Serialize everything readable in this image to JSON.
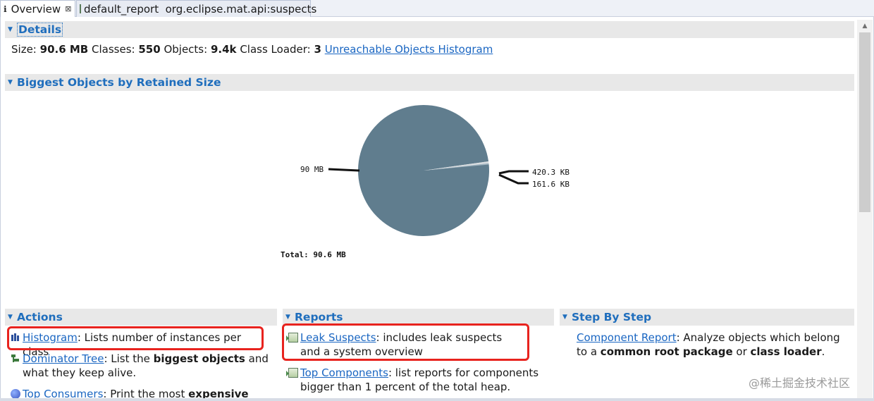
{
  "tabs": [
    {
      "icon": "info-icon",
      "label": "Overview",
      "close": "⊠"
    },
    {
      "icon": "report-icon",
      "label": "default_report  org.eclipse.mat.api:suspects"
    }
  ],
  "details": {
    "title": "Details",
    "size_label": "Size:",
    "size_value": "90.6 MB",
    "classes_label": "Classes:",
    "classes_value": "550",
    "objects_label": "Objects:",
    "objects_value": "9.4k",
    "loader_label": "Class Loader:",
    "loader_value": "3",
    "unreachable_link": "Unreachable Objects Histogram"
  },
  "biggest": {
    "title": "Biggest Objects by Retained Size"
  },
  "chart_data": {
    "type": "pie",
    "slices": [
      {
        "label": "90 MB",
        "value": 90.0,
        "color": "#607d8e"
      },
      {
        "label": "420.3 KB",
        "value": 0.4203,
        "color": "#d9dde0"
      },
      {
        "label": "161.6 KB",
        "value": 0.1616,
        "color": "#9fb3bf"
      }
    ],
    "total_label": "Total: 90.6 MB"
  },
  "actions": {
    "title": "Actions",
    "histogram_link": "Histogram",
    "histogram_desc": ": Lists number of instances per class",
    "dominator_link": "Dominator Tree",
    "dominator_desc1": ": List the ",
    "dominator_bold": "biggest objects",
    "dominator_desc2": " and what they keep alive.",
    "consumers_link": "Top Consumers",
    "consumers_desc1": ": Print the most ",
    "consumers_bold": "expensive"
  },
  "reports": {
    "title": "Reports",
    "leak_link": "Leak Suspects",
    "leak_desc": ": includes leak suspects and a system overview",
    "topcomp_link": "Top Components",
    "topcomp_desc": ": list reports for components bigger than 1 percent of the total heap."
  },
  "steps": {
    "title": "Step By Step",
    "component_link": "Component Report",
    "component_desc1": ": Analyze objects which belong to a ",
    "component_bold1": "common root package",
    "component_desc2": " or ",
    "component_bold2": "class loader",
    "component_desc3": "."
  },
  "watermark": "@稀土掘金技术社区",
  "colors": {
    "link": "#1a66c2",
    "section_title": "#1f6ebd",
    "highlight": "#e8231e",
    "pie": "#607d8e"
  }
}
